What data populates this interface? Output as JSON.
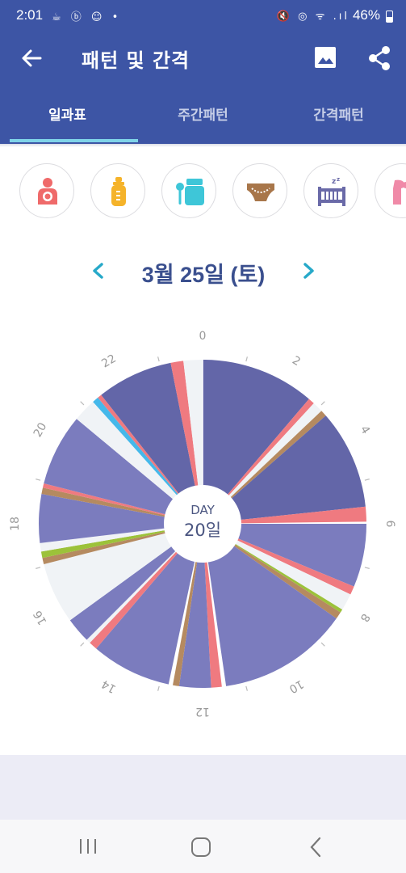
{
  "status": {
    "time": "2:01",
    "battery": "46%",
    "left_icons": "☕ ⓑ ☺ •",
    "right_icons": "🔇 ◎ ᯤ .ıl"
  },
  "app_bar": {
    "title": "패턴 및 간격"
  },
  "tabs": [
    {
      "label": "일과표",
      "active": true
    },
    {
      "label": "주간패턴",
      "active": false
    },
    {
      "label": "간격패턴",
      "active": false
    }
  ],
  "activities": [
    {
      "icon": "breastfeeding-icon",
      "color": "#ef6a6a"
    },
    {
      "icon": "bottle-icon",
      "color": "#f5b32a"
    },
    {
      "icon": "baby-food-icon",
      "color": "#3ec6d8"
    },
    {
      "icon": "diaper-icon",
      "color": "#a8764a"
    },
    {
      "icon": "sleep-icon",
      "color": "#6a6aa8"
    },
    {
      "icon": "pumping-icon",
      "color": "#f08aa8"
    }
  ],
  "date_nav": {
    "label": "3월 25일 (토)"
  },
  "chart_data": {
    "type": "radial-timeline",
    "center_label": "DAY",
    "center_value": "20일",
    "hour_ticks": [
      "0",
      "2",
      "4",
      "6",
      "8",
      "10",
      "12",
      "14",
      "16",
      "18",
      "20",
      "22"
    ],
    "category_colors": {
      "sleep": "#7b7cbe",
      "sleep_dark": "#6366a8",
      "breastfeed": "#ef7a80",
      "diaper": "#b58a60",
      "solid": "#9cc23a",
      "pumping": "#45b8ea",
      "awake": "#f0f3f6"
    },
    "segments": [
      {
        "category": "sleep_dark",
        "start": 0.0,
        "end": 2.7
      },
      {
        "category": "breastfeed",
        "start": 2.7,
        "end": 2.85
      },
      {
        "category": "awake",
        "start": 2.85,
        "end": 3.1
      },
      {
        "category": "diaper",
        "start": 3.1,
        "end": 3.25
      },
      {
        "category": "sleep_dark",
        "start": 3.25,
        "end": 5.6
      },
      {
        "category": "breastfeed",
        "start": 5.6,
        "end": 5.95
      },
      {
        "category": "sleep",
        "start": 6.0,
        "end": 7.5
      },
      {
        "category": "breastfeed",
        "start": 7.5,
        "end": 7.7
      },
      {
        "category": "awake",
        "start": 7.7,
        "end": 8.1
      },
      {
        "category": "solid",
        "start": 8.1,
        "end": 8.18
      },
      {
        "category": "diaper",
        "start": 8.18,
        "end": 8.35
      },
      {
        "category": "sleep",
        "start": 8.35,
        "end": 11.45
      },
      {
        "category": "breastfeed",
        "start": 11.55,
        "end": 11.8
      },
      {
        "category": "sleep",
        "start": 11.8,
        "end": 12.55
      },
      {
        "category": "diaper",
        "start": 12.55,
        "end": 12.7
      },
      {
        "category": "sleep",
        "start": 12.8,
        "end": 14.7
      },
      {
        "category": "breastfeed",
        "start": 14.7,
        "end": 14.9
      },
      {
        "category": "awake",
        "start": 14.9,
        "end": 15.0
      },
      {
        "category": "sleep",
        "start": 15.0,
        "end": 15.6
      },
      {
        "category": "awake",
        "start": 15.6,
        "end": 17.05
      },
      {
        "category": "diaper",
        "start": 17.05,
        "end": 17.2
      },
      {
        "category": "solid",
        "start": 17.2,
        "end": 17.35
      },
      {
        "category": "awake",
        "start": 17.35,
        "end": 17.55
      },
      {
        "category": "sleep",
        "start": 17.55,
        "end": 18.7
      },
      {
        "category": "diaper",
        "start": 18.7,
        "end": 18.85
      },
      {
        "category": "breastfeed",
        "start": 18.85,
        "end": 18.95
      },
      {
        "category": "sleep",
        "start": 18.95,
        "end": 20.65
      },
      {
        "category": "awake",
        "start": 20.65,
        "end": 21.2
      },
      {
        "category": "pumping",
        "start": 21.2,
        "end": 21.35
      },
      {
        "category": "breastfeed",
        "start": 21.35,
        "end": 21.45
      },
      {
        "category": "sleep_dark",
        "start": 21.45,
        "end": 23.25
      },
      {
        "category": "breastfeed",
        "start": 23.25,
        "end": 23.55
      },
      {
        "category": "awake",
        "start": 23.55,
        "end": 23.99
      }
    ]
  }
}
